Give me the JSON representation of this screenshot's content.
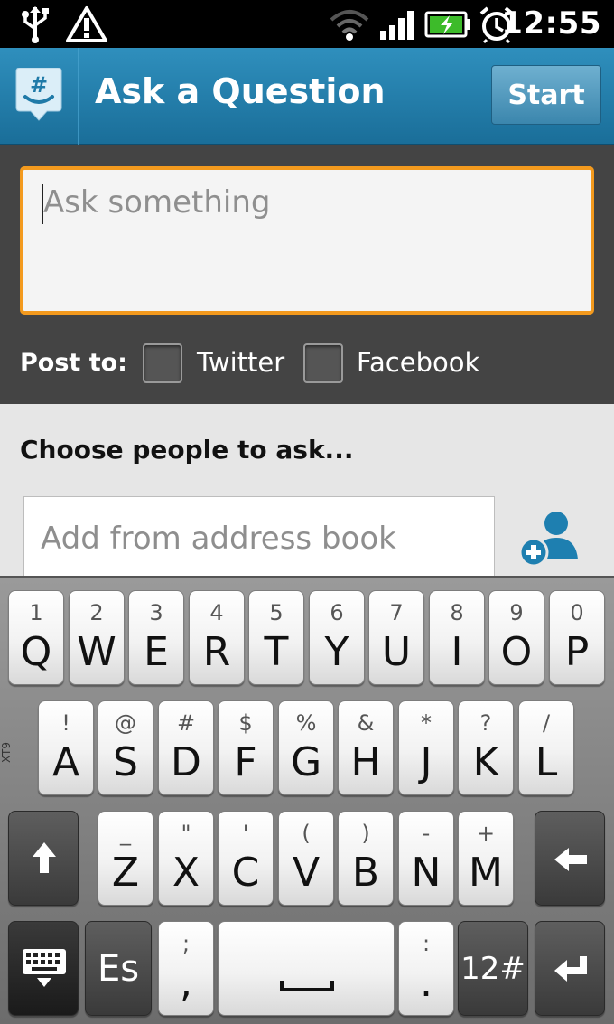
{
  "status_bar": {
    "time": "12:55",
    "icons": [
      "usb-icon",
      "warning-icon",
      "wifi-icon",
      "signal-icon",
      "battery-icon",
      "alarm-icon"
    ]
  },
  "title_bar": {
    "title": "Ask a Question",
    "start_label": "Start",
    "logo_icon": "groupme-logo-icon",
    "logo_glyph": "#",
    "accent_color": "#1f7aa8"
  },
  "ask_form": {
    "placeholder": "Ask something",
    "focus_color": "#f39a1e",
    "post_to_label": "Post to:",
    "options": [
      {
        "label": "Twitter",
        "checked": false
      },
      {
        "label": "Facebook",
        "checked": false
      }
    ]
  },
  "people": {
    "heading": "Choose people to ask...",
    "address_placeholder": "Add from address book",
    "add_icon": "add-contact-icon"
  },
  "keyboard": {
    "side_label": "XT9",
    "row1": [
      {
        "hint": "1",
        "main": "Q"
      },
      {
        "hint": "2",
        "main": "W"
      },
      {
        "hint": "3",
        "main": "E"
      },
      {
        "hint": "4",
        "main": "R"
      },
      {
        "hint": "5",
        "main": "T"
      },
      {
        "hint": "6",
        "main": "Y"
      },
      {
        "hint": "7",
        "main": "U"
      },
      {
        "hint": "8",
        "main": "I"
      },
      {
        "hint": "9",
        "main": "O"
      },
      {
        "hint": "0",
        "main": "P"
      }
    ],
    "row2": [
      {
        "hint": "!",
        "main": "A"
      },
      {
        "hint": "@",
        "main": "S"
      },
      {
        "hint": "#",
        "main": "D"
      },
      {
        "hint": "$",
        "main": "F"
      },
      {
        "hint": "%",
        "main": "G"
      },
      {
        "hint": "&",
        "main": "H"
      },
      {
        "hint": "*",
        "main": "J"
      },
      {
        "hint": "?",
        "main": "K"
      },
      {
        "hint": "/",
        "main": "L"
      }
    ],
    "row3": [
      {
        "hint": "_",
        "main": "Z"
      },
      {
        "hint": "\"",
        "main": "X"
      },
      {
        "hint": "'",
        "main": "C"
      },
      {
        "hint": "(",
        "main": "V"
      },
      {
        "hint": ")",
        "main": "B"
      },
      {
        "hint": "-",
        "main": "N"
      },
      {
        "hint": "+",
        "main": "M"
      }
    ],
    "lang_label": "Es",
    "comma_hint": ";",
    "comma_main": ",",
    "period_hint": ":",
    "period_main": ".",
    "symbols_label": "12#"
  }
}
